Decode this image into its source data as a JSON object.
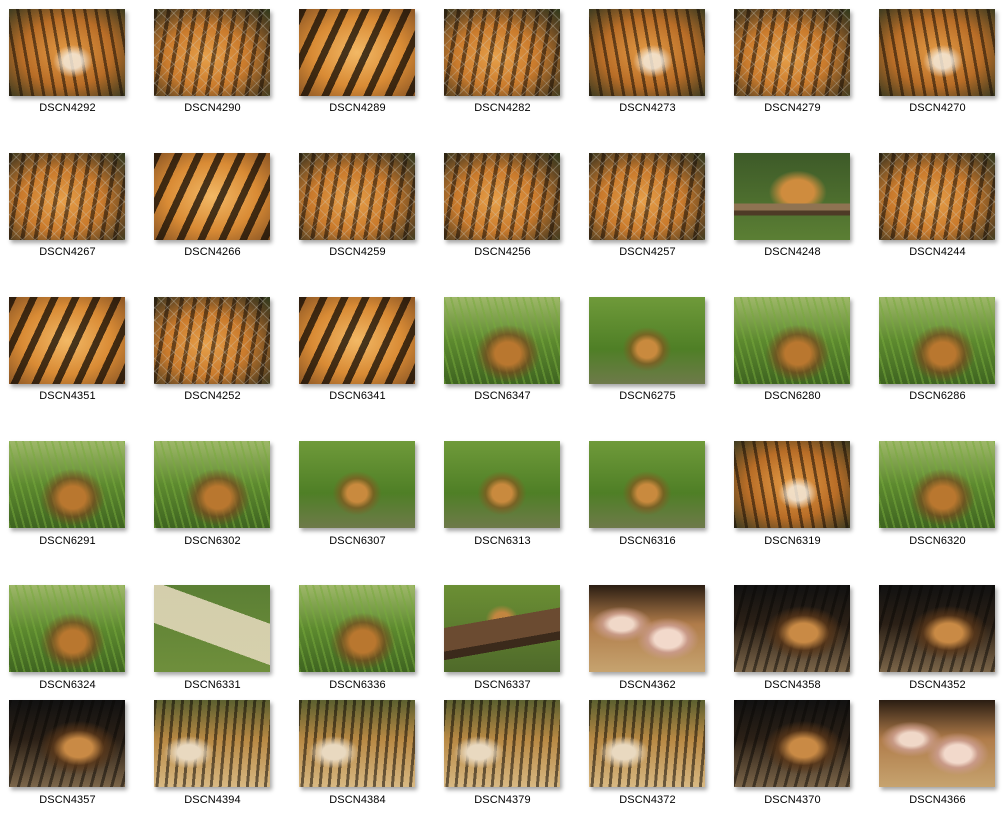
{
  "thumbnails": [
    {
      "label": "DSCN4292",
      "look": "t-tiger-face"
    },
    {
      "label": "DSCN4290",
      "look": "t-tiger-fence"
    },
    {
      "label": "DSCN4289",
      "look": "t-tiger-close"
    },
    {
      "label": "DSCN4282",
      "look": "t-tiger-fence"
    },
    {
      "label": "DSCN4273",
      "look": "t-tiger-face"
    },
    {
      "label": "DSCN4279",
      "look": "t-tiger-fence"
    },
    {
      "label": "DSCN4270",
      "look": "t-tiger-face"
    },
    {
      "label": "DSCN4267",
      "look": "t-tiger-fence"
    },
    {
      "label": "DSCN4266",
      "look": "t-tiger-close"
    },
    {
      "label": "DSCN4259",
      "look": "t-tiger-fence"
    },
    {
      "label": "DSCN4256",
      "look": "t-tiger-fence"
    },
    {
      "label": "DSCN4257",
      "look": "t-tiger-fence"
    },
    {
      "label": "DSCN4248",
      "look": "t-platform"
    },
    {
      "label": "DSCN4244",
      "look": "t-tiger-fence"
    },
    {
      "label": "DSCN4351",
      "look": "t-tiger-close"
    },
    {
      "label": "DSCN4252",
      "look": "t-tiger-fence"
    },
    {
      "label": "DSCN6341",
      "look": "t-tiger-close"
    },
    {
      "label": "DSCN6347",
      "look": "t-grass-cub"
    },
    {
      "label": "DSCN6275",
      "look": "t-lawn-cub"
    },
    {
      "label": "DSCN6280",
      "look": "t-grass-cub"
    },
    {
      "label": "DSCN6286",
      "look": "t-grass-cub"
    },
    {
      "label": "DSCN6291",
      "look": "t-grass-cub"
    },
    {
      "label": "DSCN6302",
      "look": "t-grass-cub"
    },
    {
      "label": "DSCN6307",
      "look": "t-lawn-cub"
    },
    {
      "label": "DSCN6313",
      "look": "t-lawn-cub"
    },
    {
      "label": "DSCN6316",
      "look": "t-lawn-cub"
    },
    {
      "label": "DSCN6319",
      "look": "t-tiger-face"
    },
    {
      "label": "DSCN6320",
      "look": "t-grass-cub"
    },
    {
      "label": "DSCN6324",
      "look": "t-grass-cub"
    },
    {
      "label": "DSCN6331",
      "look": "t-rock"
    },
    {
      "label": "DSCN6336",
      "look": "t-grass-cub"
    },
    {
      "label": "DSCN6337",
      "look": "t-log"
    },
    {
      "label": "DSCN4362",
      "look": "t-paws"
    },
    {
      "label": "DSCN4358",
      "look": "t-dark-sleep"
    },
    {
      "label": "DSCN4352",
      "look": "t-dark-sleep"
    },
    {
      "label": "DSCN4357",
      "look": "t-dark-sleep"
    },
    {
      "label": "DSCN4394",
      "look": "t-sun-sleep"
    },
    {
      "label": "DSCN4384",
      "look": "t-sun-sleep"
    },
    {
      "label": "DSCN4379",
      "look": "t-sun-sleep"
    },
    {
      "label": "DSCN4372",
      "look": "t-sun-sleep"
    },
    {
      "label": "DSCN4370",
      "look": "t-dark-sleep"
    },
    {
      "label": "DSCN4366",
      "look": "t-paws"
    }
  ]
}
